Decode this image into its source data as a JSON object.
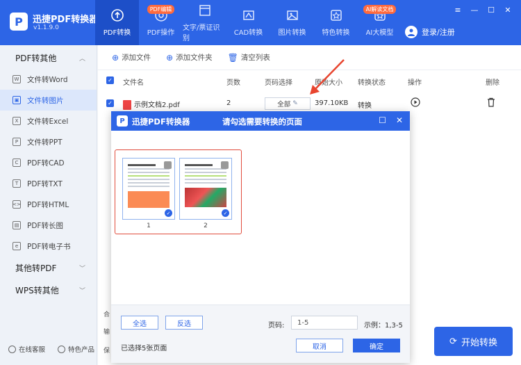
{
  "app": {
    "logo_letter": "P",
    "title": "迅捷PDF转换器",
    "version": "v1.1.9.0"
  },
  "nav": [
    {
      "label": "PDF转换",
      "badge": "",
      "icon": "convert-icon"
    },
    {
      "label": "PDF操作",
      "badge": "PDF编辑",
      "icon": "pdf-edit-icon"
    },
    {
      "label": "文字/票证识别",
      "badge": "",
      "icon": "ocr-icon"
    },
    {
      "label": "CAD转换",
      "badge": "",
      "icon": "cad-icon"
    },
    {
      "label": "图片转换",
      "badge": "",
      "icon": "image-icon"
    },
    {
      "label": "特色转换",
      "badge": "",
      "icon": "star-icon"
    },
    {
      "label": "AI大模型",
      "badge": "AI解读文档",
      "icon": "ai-icon"
    }
  ],
  "user": {
    "login_label": "登录/注册"
  },
  "window_controls": {
    "menu": "≡",
    "minimize": "—",
    "maximize": "☐",
    "close": "✕"
  },
  "sidebar": {
    "group1": "PDF转其他",
    "items": [
      {
        "label": "文件转Word",
        "icon": "W"
      },
      {
        "label": "文件转图片",
        "icon": "▣"
      },
      {
        "label": "文件转Excel",
        "icon": "X"
      },
      {
        "label": "文件转PPT",
        "icon": "P"
      },
      {
        "label": "PDF转CAD",
        "icon": "C"
      },
      {
        "label": "PDF转TXT",
        "icon": "T"
      },
      {
        "label": "PDF转HTML",
        "icon": "<>"
      },
      {
        "label": "PDF转长图",
        "icon": "▤"
      },
      {
        "label": "PDF转电子书",
        "icon": "e"
      }
    ],
    "group2": "其他转PDF",
    "group3": "WPS转其他",
    "footer": {
      "service": "在线客服",
      "products": "特色产品"
    }
  },
  "toolbar": {
    "add_file": "添加文件",
    "add_folder": "添加文件夹",
    "clear_list": "清空列表"
  },
  "table": {
    "headers": {
      "name": "文件名",
      "pages": "页数",
      "page_select": "页码选择",
      "size": "原始大小",
      "status": "转换状态",
      "action": "操作",
      "delete": "删除"
    },
    "rows": [
      {
        "name": "示例文档2.pdf",
        "pages": "2",
        "page_select": "全部",
        "size": "397.10KB",
        "status": "转换"
      }
    ]
  },
  "main_peek": {
    "l1": "合",
    "l2": "输",
    "l3": "保"
  },
  "start_button": "开始转换",
  "dialog": {
    "logo_letter": "P",
    "app_title": "迅捷PDF转换器",
    "title": "请勾选需要转换的页面",
    "pages": [
      {
        "number": "1",
        "selected": true
      },
      {
        "number": "2",
        "selected": true
      }
    ],
    "select_all": "全选",
    "invert": "反选",
    "range_label": "页码:",
    "range_value": "1-5",
    "example": "示例：1,3-5",
    "status": "已选择5张页面",
    "cancel": "取消",
    "confirm": "确定"
  }
}
